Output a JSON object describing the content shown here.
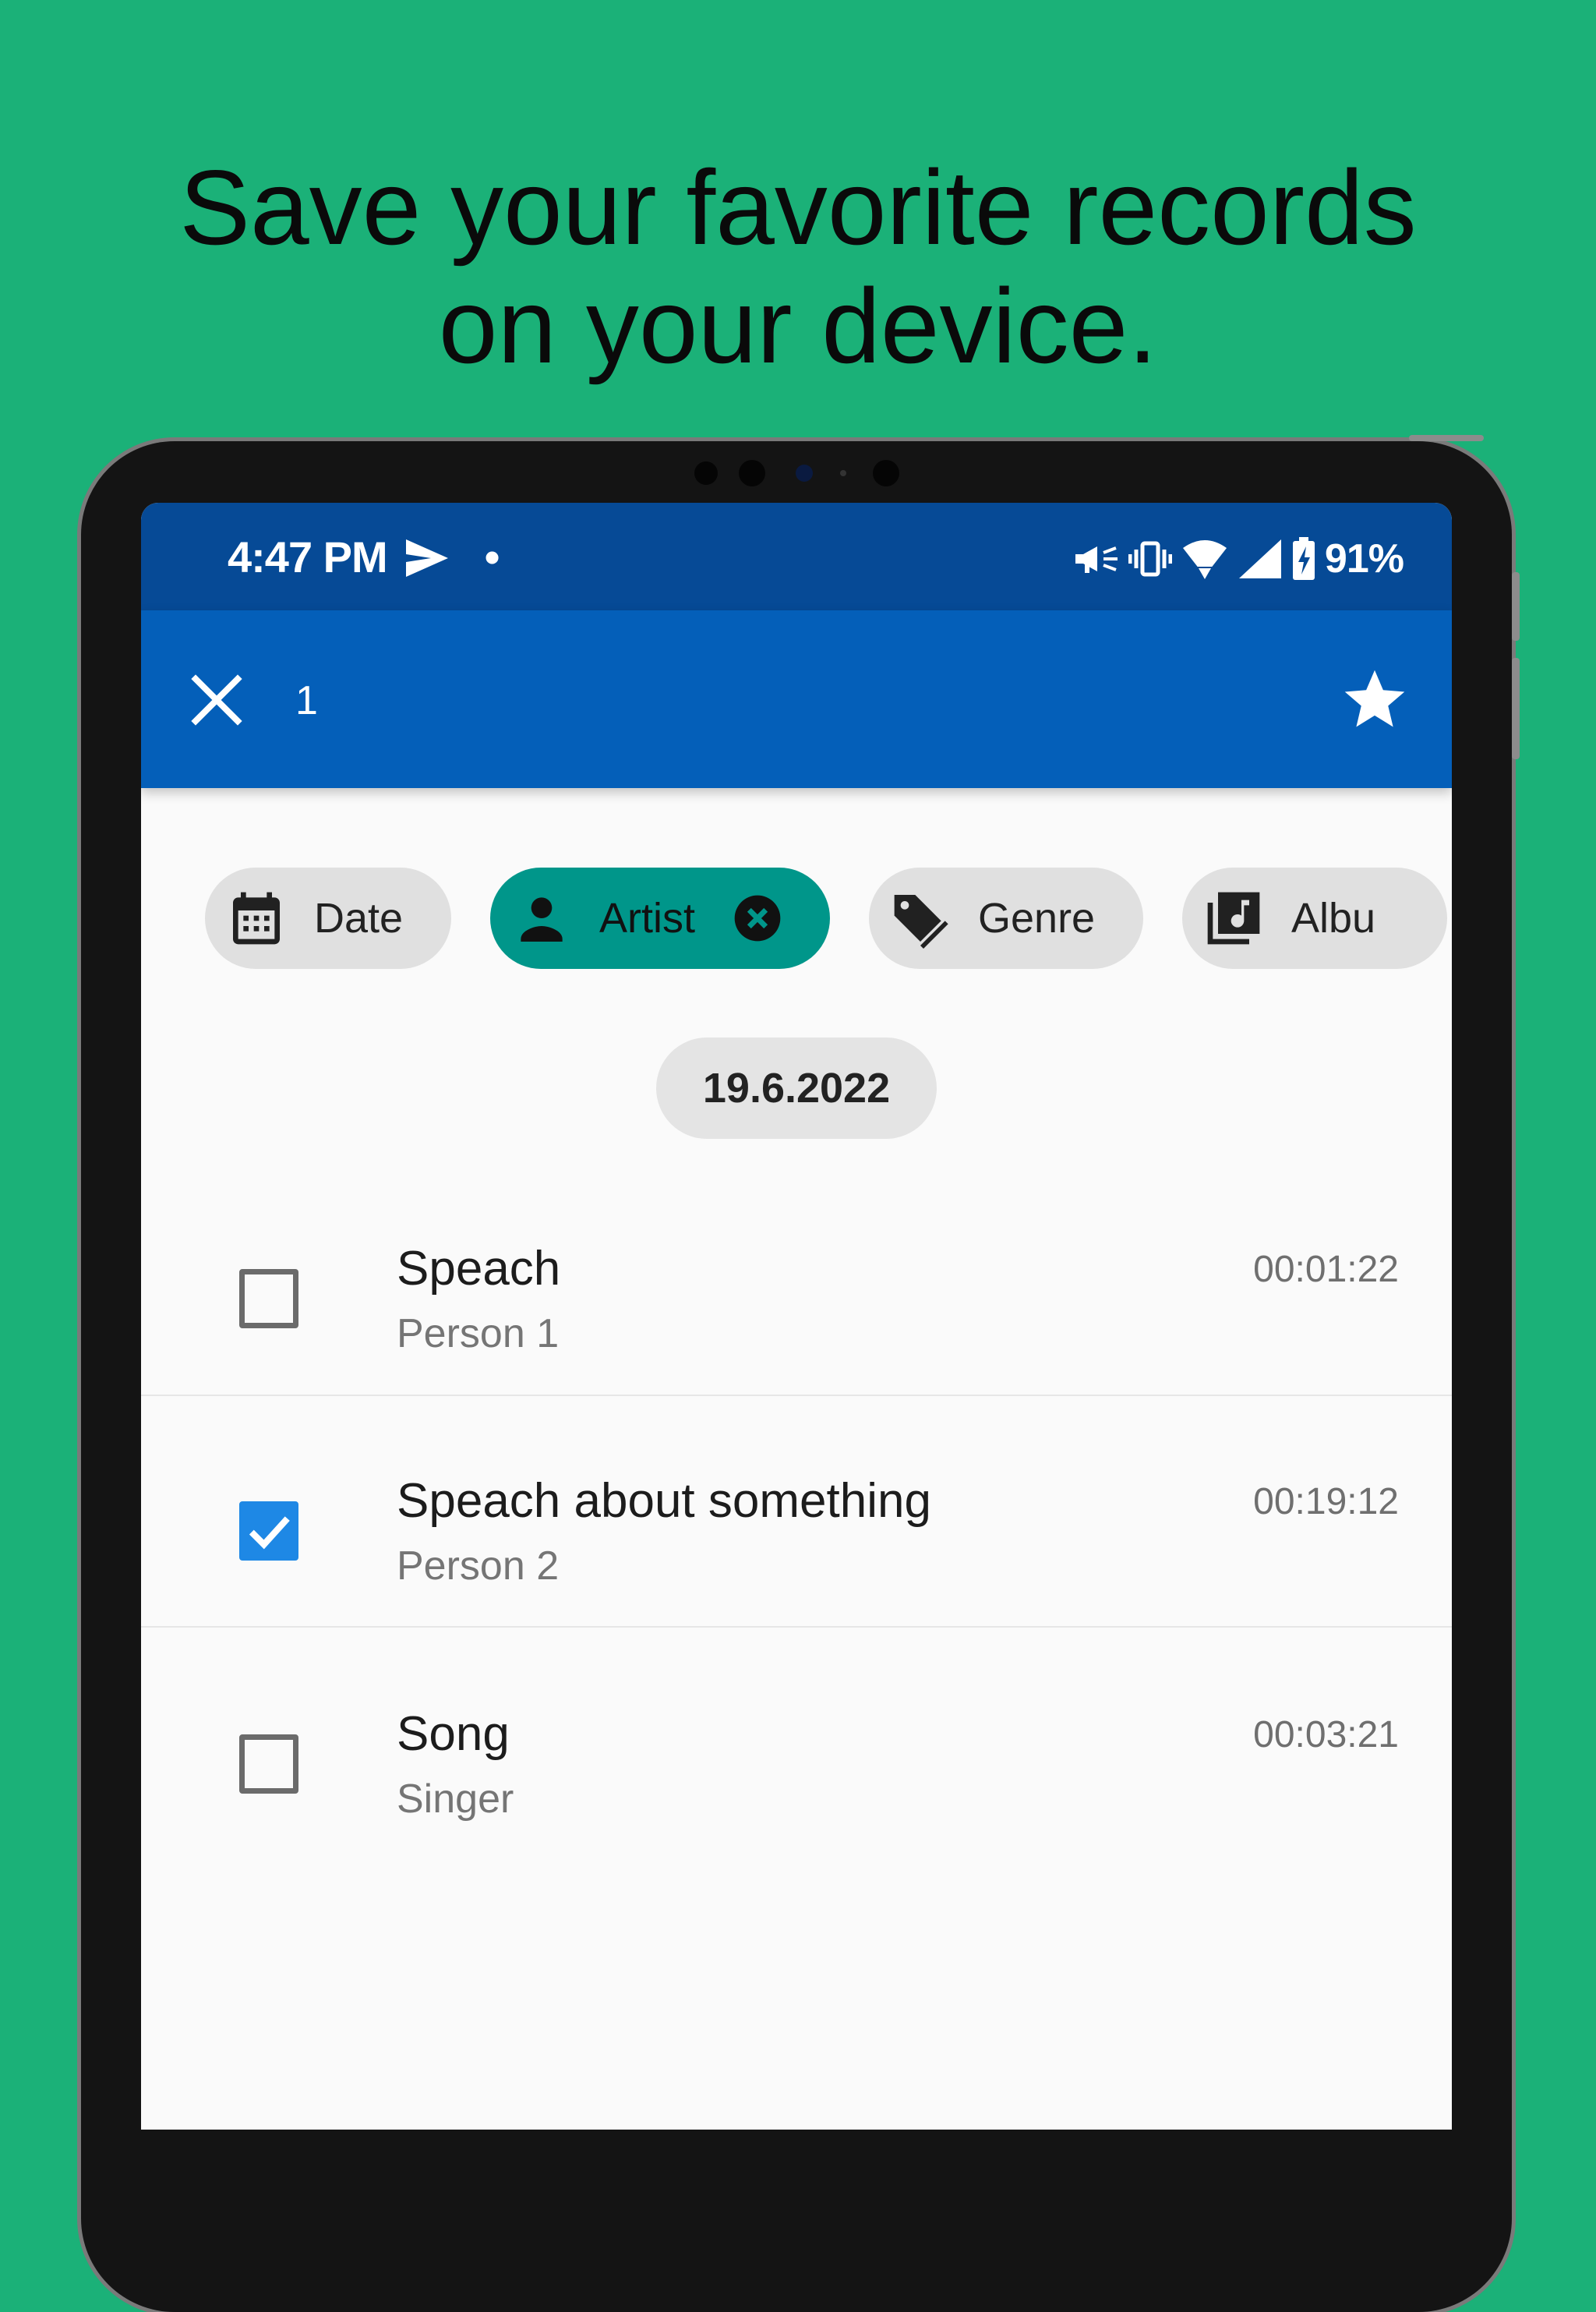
{
  "headline": {
    "line1": "Save your favorite records",
    "line2": "on your device."
  },
  "status_bar": {
    "time": "4:47 PM",
    "dot": "•",
    "battery": "91%",
    "icons": [
      "send-icon",
      "mute-icon",
      "vibrate-icon",
      "wifi-icon",
      "signal-icon",
      "battery-icon"
    ]
  },
  "app_bar": {
    "selected_count": "1",
    "close_icon": "close-icon",
    "favorite_icon": "star-icon"
  },
  "chips": [
    {
      "label": "Date",
      "icon": "calendar-icon",
      "active": false
    },
    {
      "label": "Artist",
      "icon": "person-icon",
      "active": true
    },
    {
      "label": "Genre",
      "icon": "tag-icon",
      "active": false
    },
    {
      "label": "Albu",
      "icon": "album-icon",
      "active": false
    }
  ],
  "date_header": "19.6.2022",
  "records": [
    {
      "title": "Speach",
      "artist": "Person 1",
      "duration": "00:01:22",
      "checked": false
    },
    {
      "title": "Speach about something",
      "artist": "Person 2",
      "duration": "00:19:12",
      "checked": true
    },
    {
      "title": "Song",
      "artist": "Singer",
      "duration": "00:03:21",
      "checked": false
    }
  ],
  "colors": {
    "background": "#1bb178",
    "status_bar": "#064a96",
    "app_bar": "#045fb9",
    "active_chip": "#00968a",
    "checkbox_checked": "#1e88e5"
  }
}
